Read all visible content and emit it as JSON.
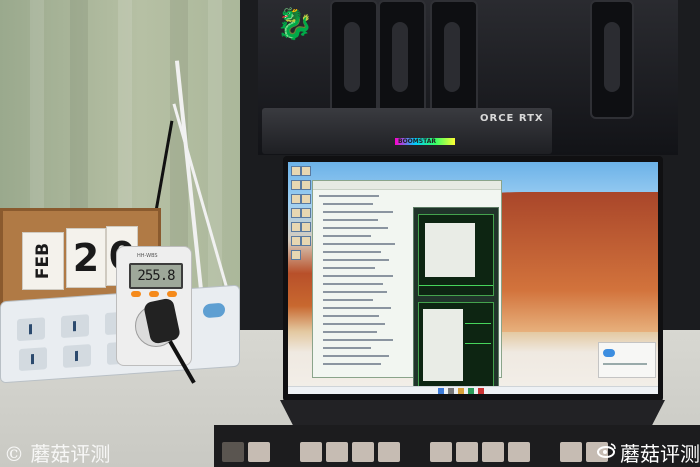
{
  "photo": {
    "subject": "",
    "gpu_label": "ORCE RTX",
    "rgb_label": "BOOMSTAR",
    "power_meter": {
      "brand": "HH-WBS",
      "reading": "255.8"
    },
    "calendar": {
      "month": "FEB",
      "day": "20"
    }
  },
  "watermark": {
    "left_text": "© 蘑菇评测",
    "right_text": "蘑菇评测",
    "right_icon": "weibo-icon"
  },
  "colors": {
    "msi_red": "#c3141d",
    "meter_lcd": "#9ea89a",
    "graph_green": "#46d45b"
  }
}
